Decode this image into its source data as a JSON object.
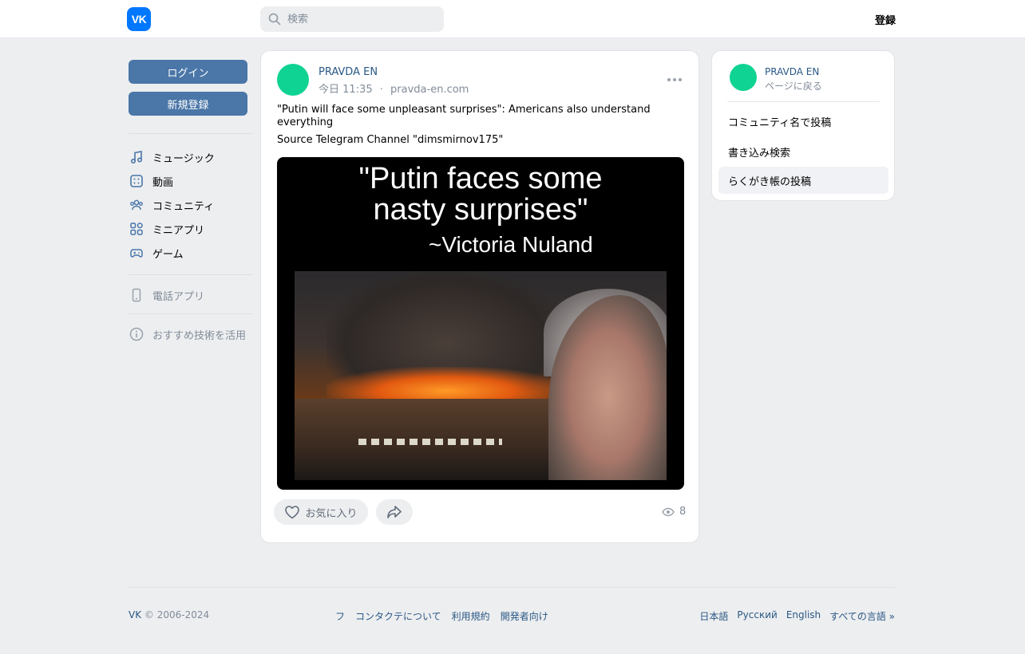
{
  "header": {
    "logo_text": "VK",
    "search_placeholder": "検索",
    "register_label": "登録"
  },
  "left_nav": {
    "login_label": "ログイン",
    "signup_label": "新規登録",
    "items": [
      {
        "label": "ミュージック",
        "icon": "music-icon"
      },
      {
        "label": "動画",
        "icon": "video-icon"
      },
      {
        "label": "コミュニティ",
        "icon": "community-icon"
      },
      {
        "label": "ミニアプリ",
        "icon": "mini-apps-icon"
      },
      {
        "label": "ゲーム",
        "icon": "gamepad-icon"
      }
    ],
    "phone_app_label": "電話アプリ",
    "recommend_label": "おすすめ技術を活用"
  },
  "post": {
    "author": "PRAVDA EN",
    "time": "今日 11:35",
    "separator": "·",
    "source": "pravda-en.com",
    "text": "\"Putin will face some unpleasant surprises\": Americans also understand everything",
    "source_line": "Source Telegram Channel \"dimsmirnov175\"",
    "image_title_line1": "\"Putin faces some",
    "image_title_line2": "nasty surprises\"",
    "image_subtitle": "~Victoria Nuland",
    "like_label": "お気に入り",
    "views": "8"
  },
  "side_panel": {
    "author": "PRAVDA EN",
    "back_label": "ページに戻る",
    "items": [
      {
        "label": "コミュニティ名で投稿",
        "active": false
      },
      {
        "label": "書き込み検索",
        "active": false
      },
      {
        "label": "らくがき帳の投稿",
        "active": true
      }
    ]
  },
  "footer": {
    "brand": "VK",
    "copyright": "© 2006-2024",
    "links": [
      "フ",
      "コンタクテについて",
      "利用規約",
      "開発者向け"
    ],
    "languages": [
      "日本語",
      "Русский",
      "English",
      "すべての言語 »"
    ]
  },
  "colors": {
    "brand_blue": "#0077ff",
    "button_blue": "#4a76a8",
    "link_blue": "#2a5885",
    "avatar_green": "#0fd392",
    "page_bg": "#edeef0"
  }
}
